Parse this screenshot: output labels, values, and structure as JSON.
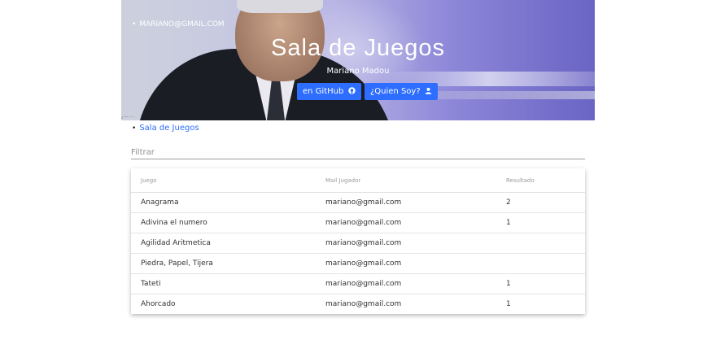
{
  "header": {
    "title": "Sala de Juegos",
    "subtitle": "Mariano Madou",
    "github_button": "en GitHub",
    "about_button": "¿Quien Soy?",
    "overlay_email": "MARIANO@GMAIL.COM"
  },
  "nav": {
    "link": "Sala de Juegos"
  },
  "filter": {
    "placeholder": "Filtrar",
    "value": ""
  },
  "table": {
    "headers": [
      "Juego",
      "Mail Jugador",
      "Resultado"
    ],
    "rows": [
      {
        "juego": "Anagrama",
        "mail": "mariano@gmail.com",
        "resultado": "2"
      },
      {
        "juego": "Adivina el numero",
        "mail": "mariano@gmail.com",
        "resultado": "1"
      },
      {
        "juego": "Agilidad Aritmetica",
        "mail": "mariano@gmail.com",
        "resultado": ""
      },
      {
        "juego": "Piedra, Papel, Tijera",
        "mail": "mariano@gmail.com",
        "resultado": ""
      },
      {
        "juego": "Tateti",
        "mail": "mariano@gmail.com",
        "resultado": "1"
      },
      {
        "juego": "Ahorcado",
        "mail": "mariano@gmail.com",
        "resultado": "1"
      }
    ]
  },
  "colors": {
    "accent": "#2d6dff",
    "hero_overlay": "#8c87d8"
  },
  "icons": {
    "github": "github-icon",
    "user": "user-icon"
  }
}
